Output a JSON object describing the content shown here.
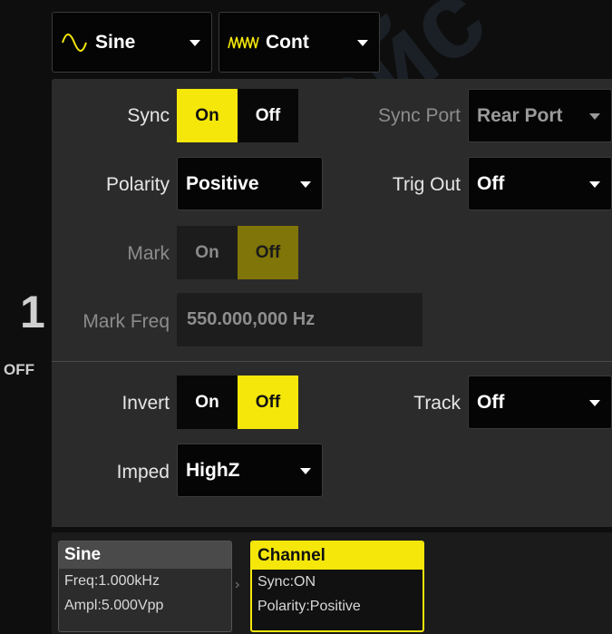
{
  "top": {
    "waveform": {
      "icon": "sine-wave-icon",
      "label": "Sine"
    },
    "mode": {
      "icon": "burst-wave-icon",
      "label": "Cont"
    }
  },
  "settings": {
    "sync": {
      "label": "Sync",
      "on": "On",
      "off": "Off",
      "selected": "On"
    },
    "sync_port": {
      "label": "Sync Port",
      "value": "Rear Port"
    },
    "polarity": {
      "label": "Polarity",
      "value": "Positive"
    },
    "trig_out": {
      "label": "Trig Out",
      "value": "Off"
    },
    "mark": {
      "label": "Mark",
      "on": "On",
      "off": "Off",
      "selected": "Off"
    },
    "mark_freq": {
      "label": "Mark Freq",
      "value": "550.000,000 Hz"
    },
    "invert": {
      "label": "Invert",
      "on": "On",
      "off": "Off",
      "selected": "Off"
    },
    "track": {
      "label": "Track",
      "value": "Off"
    },
    "imped": {
      "label": "Imped",
      "value": "HighZ"
    }
  },
  "side": {
    "digit": "1",
    "off_text": "OFF"
  },
  "cards": {
    "sine": {
      "title": "Sine",
      "line1": "Freq:1.000kHz",
      "line2": "Ampl:5.000Vpp"
    },
    "channel": {
      "title": "Channel",
      "line1": "Sync:ON",
      "line2": "Polarity:Positive"
    }
  },
  "watermark": {
    "text": "суперайс"
  },
  "colors": {
    "accent": "#f5e70a",
    "panel": "#2b2b2b",
    "background": "#0e0e0e"
  }
}
